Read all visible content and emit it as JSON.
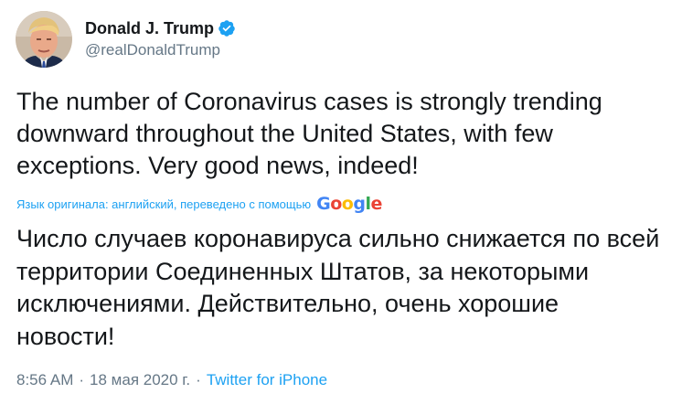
{
  "user": {
    "display_name": "Donald J. Trump",
    "handle": "@realDonaldTrump",
    "verified": true,
    "avatar_icon": "profile-photo"
  },
  "tweet": {
    "text": "The number of Coronavirus cases is strongly trending downward throughout the United States, with few exceptions. Very good news, indeed!",
    "translation_note": "Язык оригинала: английский, переведено с помощью",
    "translator": "Google",
    "translated_text": "Число случаев коронавируса сильно снижается по всей территории Соединенных Штатов, за некоторыми исключениями. Действительно, очень хорошие новости!",
    "time": "8:56 AM",
    "date": "18 мая 2020 г.",
    "separator": "·",
    "source": "Twitter for iPhone"
  },
  "colors": {
    "link": "#1da1f2",
    "secondary": "#657786",
    "text": "#14171a"
  }
}
